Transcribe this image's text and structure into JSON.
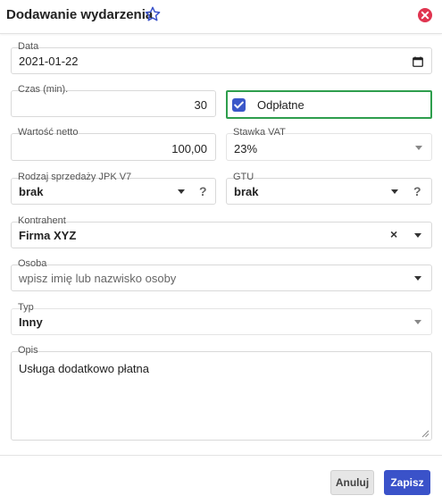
{
  "dialog": {
    "title": "Dodawanie wydarzenia"
  },
  "form": {
    "data": {
      "label": "Data",
      "value": "2021-01-22"
    },
    "czas": {
      "label": "Czas (min).",
      "value": "30"
    },
    "odplatne": {
      "label": "Odpłatne",
      "checked": true
    },
    "wartosc_netto": {
      "label": "Wartość netto",
      "value": "100,00"
    },
    "stawka_vat": {
      "label": "Stawka VAT",
      "value": "23%"
    },
    "rodzaj_sprzedazy": {
      "label": "Rodzaj sprzedaży JPK V7",
      "value": "brak",
      "help": "?"
    },
    "gtu": {
      "label": "GTU",
      "value": "brak",
      "help": "?"
    },
    "kontrahent": {
      "label": "Kontrahent",
      "value": "Firma XYZ",
      "clear": "×"
    },
    "osoba": {
      "label": "Osoba",
      "placeholder": "wpisz imię lub nazwisko osoby"
    },
    "typ": {
      "label": "Typ",
      "value": "Inny"
    },
    "opis": {
      "label": "Opis",
      "value": "Usługa dodatkowo płatna"
    }
  },
  "footer": {
    "cancel_label": "Anuluj",
    "save_label": "Zapisz"
  },
  "icons": {
    "favorite": "star-icon",
    "close": "close-icon",
    "calendar": "calendar-icon",
    "dropdown": "chevron-down-icon"
  },
  "colors": {
    "accent": "#3a52c9",
    "checkbox": "#3a57c9",
    "highlight_border": "#2e9e4d",
    "close": "#e0344f"
  }
}
